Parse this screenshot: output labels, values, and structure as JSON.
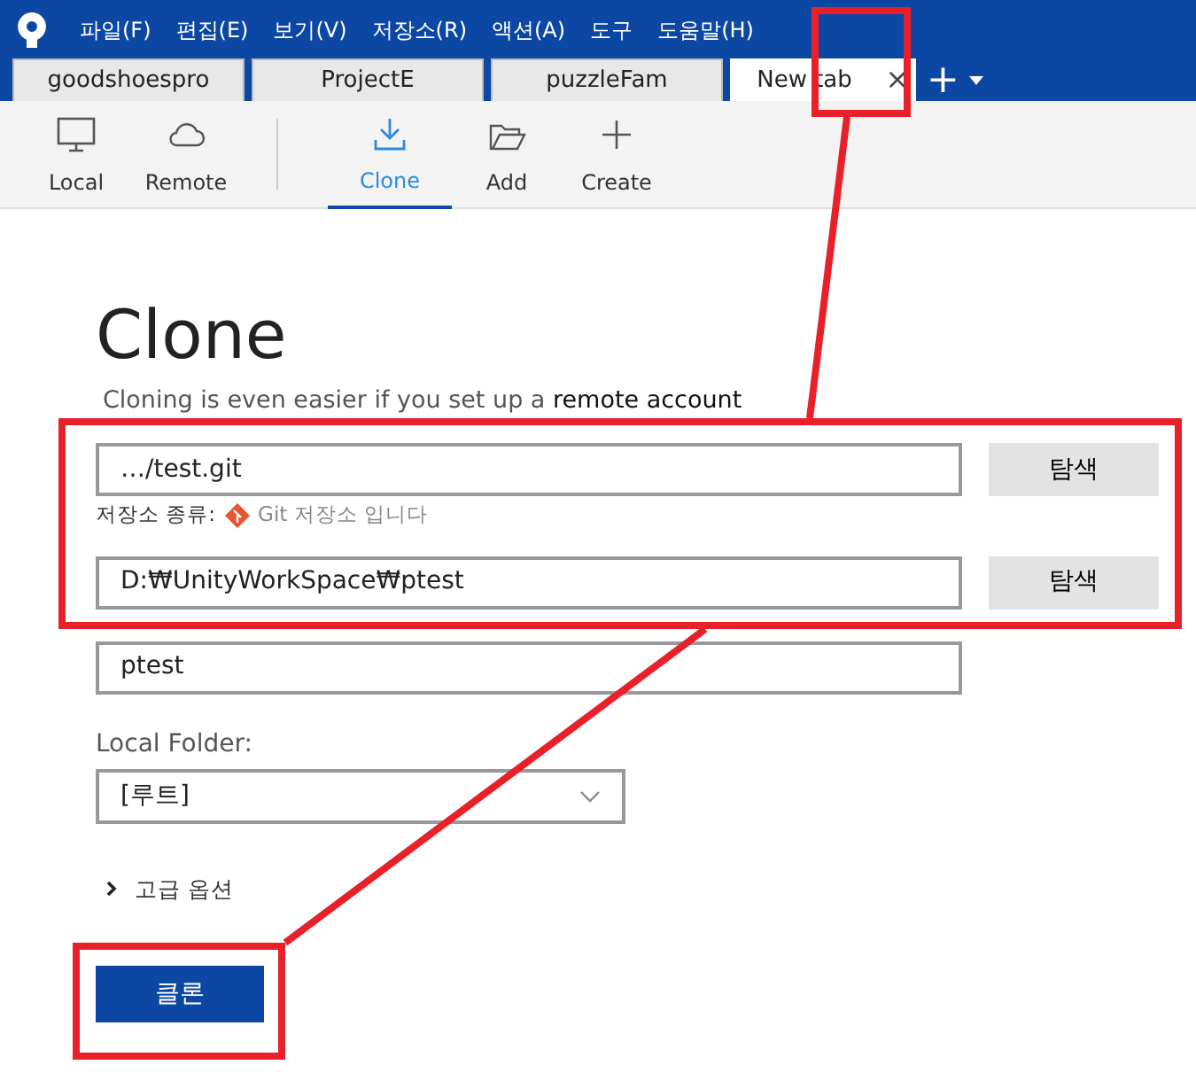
{
  "menu": [
    "파일(F)",
    "편집(E)",
    "보기(V)",
    "저장소(R)",
    "액션(A)",
    "도구",
    "도움말(H)"
  ],
  "tabs": [
    {
      "label": "goodshoespro",
      "selected": false
    },
    {
      "label": "ProjectE",
      "selected": false
    },
    {
      "label": "puzzleFam",
      "selected": false
    },
    {
      "label": "New tab",
      "selected": true
    }
  ],
  "tab_close": "×",
  "new_tab": "+",
  "toolbar": [
    {
      "label": "Local",
      "kind": "local",
      "selected": false
    },
    {
      "label": "Remote",
      "kind": "remote",
      "selected": false
    },
    {
      "label": "Clone",
      "kind": "clone",
      "selected": true
    },
    {
      "label": "Add",
      "kind": "add",
      "selected": false
    },
    {
      "label": "Create",
      "kind": "create",
      "selected": false
    }
  ],
  "clone": {
    "heading": "Clone",
    "subtitle": "Cloning is even easier if you set up a",
    "subtitle_link": "remote account",
    "source_url": "…/test.git",
    "browse_1": "탐색",
    "repo_type_label": "저장소 종류:",
    "repo_type_value": "Git 저장소 입니다",
    "destination_path": "D:₩UnityWorkSpace₩ptest",
    "browse_2": "탐색",
    "name": "ptest",
    "local_folder_label": "Local Folder:",
    "local_folder_value": "[루트]",
    "advanced": "고급 옵션",
    "clone_button": "클론"
  }
}
